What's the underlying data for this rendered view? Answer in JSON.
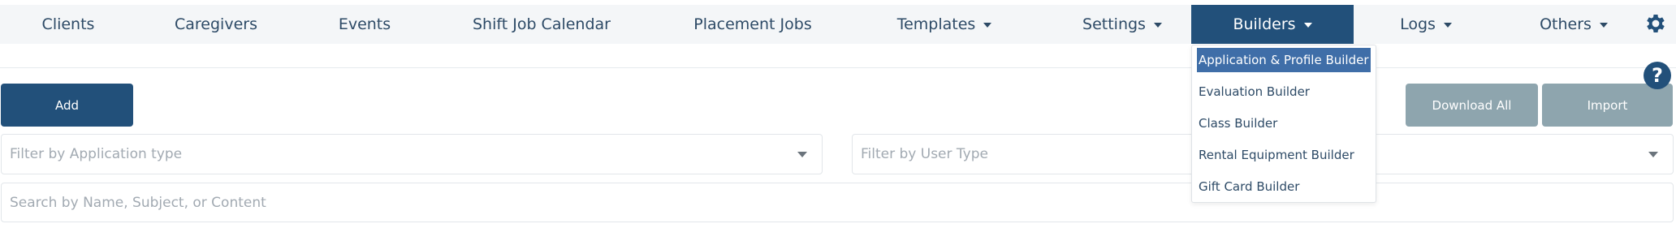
{
  "nav": {
    "items": [
      {
        "label": "Clients",
        "has_caret": false
      },
      {
        "label": "Caregivers",
        "has_caret": false
      },
      {
        "label": "Events",
        "has_caret": false
      },
      {
        "label": "Shift Job Calendar",
        "has_caret": false
      },
      {
        "label": "Placement Jobs",
        "has_caret": false
      },
      {
        "label": "Templates",
        "has_caret": true
      },
      {
        "label": "Settings",
        "has_caret": true
      },
      {
        "label": "Builders",
        "has_caret": true,
        "active": true
      },
      {
        "label": "Logs",
        "has_caret": true
      },
      {
        "label": "Others",
        "has_caret": true
      }
    ],
    "settings_icon": "gear-icon"
  },
  "builders_menu": {
    "items": [
      {
        "label": "Application & Profile Builder",
        "selected": true
      },
      {
        "label": "Evaluation Builder"
      },
      {
        "label": "Class Builder"
      },
      {
        "label": "Rental Equipment Builder"
      },
      {
        "label": "Gift Card Builder"
      }
    ]
  },
  "toolbar": {
    "add_label": "Add",
    "download_all_label": "Download All",
    "import_label": "Import",
    "help_icon": "question-icon",
    "help_glyph": "?"
  },
  "filters": {
    "application_type_placeholder": "Filter by Application type",
    "user_type_placeholder": "Filter by User Type",
    "search_placeholder": "Search by Name, Subject, or Content"
  },
  "colors": {
    "primary": "#22507a",
    "secondary_button": "#8ea5ae",
    "nav_background": "#f4f6f8",
    "selection": "#3f6ea8"
  }
}
